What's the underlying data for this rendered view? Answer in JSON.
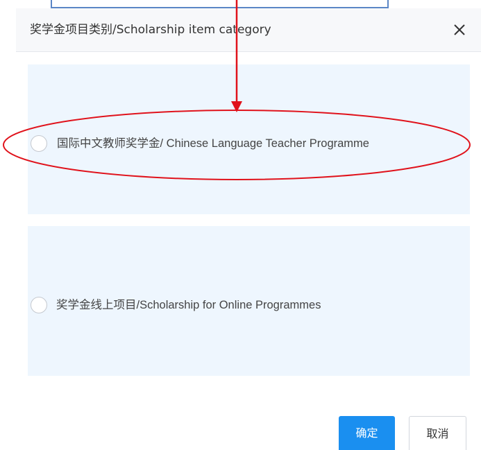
{
  "dialog": {
    "title": "奖学金项目类别/Scholarship item category",
    "close_icon": "close-icon"
  },
  "options": [
    {
      "label": "国际中文教师奖学金/ Chinese Language Teacher Programme",
      "selected": false
    },
    {
      "label": "奖学金线上项目/Scholarship for Online Programmes",
      "selected": false
    }
  ],
  "buttons": {
    "confirm_label": "确定",
    "cancel_label": "取消"
  },
  "annotation": {
    "color": "#e0121b",
    "shapes": [
      "arrow",
      "ellipse"
    ]
  },
  "colors": {
    "primary": "#1a8ff0",
    "card_bg": "#eef6fe",
    "header_bg": "#f7f8fa"
  }
}
